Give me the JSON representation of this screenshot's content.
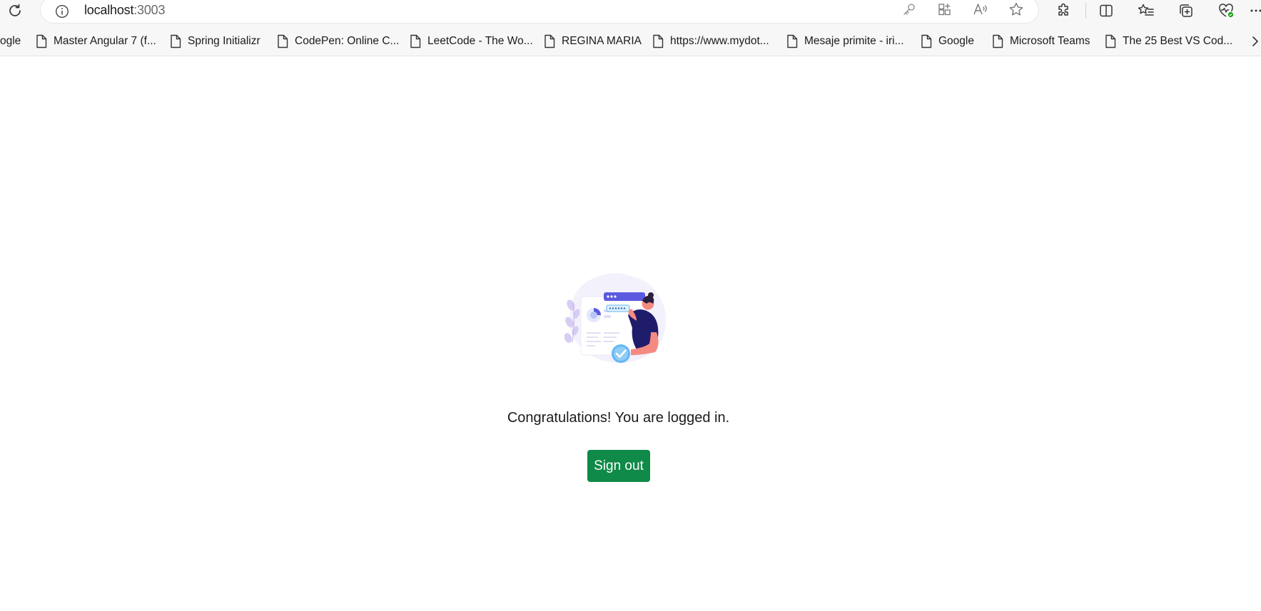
{
  "browser": {
    "url_host": "localhost",
    "url_port": ":3003",
    "favorites": [
      {
        "label": "ogle"
      },
      {
        "label": "Master Angular 7 (f..."
      },
      {
        "label": "Spring Initializr"
      },
      {
        "label": "CodePen: Online C..."
      },
      {
        "label": "LeetCode - The Wo..."
      },
      {
        "label": "REGINA MARIA"
      },
      {
        "label": "https://www.mydot..."
      },
      {
        "label": "Mesaje primite - iri..."
      },
      {
        "label": "Google"
      },
      {
        "label": "Microsoft Teams"
      },
      {
        "label": "The 25 Best VS Cod..."
      }
    ],
    "icons": {
      "reload": "reload-icon",
      "info": "info-icon",
      "password": "key-icon",
      "apps": "apps-icon",
      "read_aloud": "read-aloud-icon",
      "favorite": "star-icon",
      "extensions": "puzzle-icon",
      "split_screen": "split-screen-icon",
      "favorites": "favorites-list-icon",
      "collections": "collections-icon",
      "browser_essentials": "heart-pulse-icon",
      "more": "more-icon",
      "page": "page-icon",
      "chevron": "chevron-right-icon"
    }
  },
  "page": {
    "message": "Congratulations! You are logged in.",
    "signout_label": "Sign out"
  },
  "colors": {
    "signout_bg": "#0f8a48",
    "illustration_accent": "#5b59e0",
    "illustration_skin": "#f48b82",
    "illustration_shirt": "#1f1c6b",
    "check_circle": "#65b7f2"
  }
}
